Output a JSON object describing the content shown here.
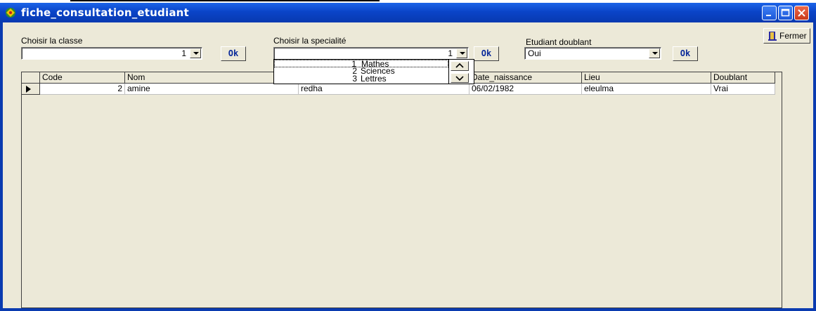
{
  "window": {
    "title": "fiche_consultation_etudiant"
  },
  "classe": {
    "label": "Choisir la classe",
    "value": "1",
    "ok": "Ok"
  },
  "specialite": {
    "label": "Choisir la specialité",
    "value": "1",
    "ok": "Ok",
    "options": [
      {
        "num": "1",
        "label": "Mathes"
      },
      {
        "num": "2",
        "label": "Sciences"
      },
      {
        "num": "3",
        "label": "Lettres"
      }
    ]
  },
  "doublant": {
    "label": "Etudiant doublant",
    "value": "Oui",
    "ok": "Ok"
  },
  "fermer": {
    "label": "Fermer"
  },
  "grid": {
    "columns": [
      "Code",
      "Nom",
      "",
      "Date_naissance",
      "Lieu",
      "Doublant"
    ],
    "rows": [
      [
        "2",
        "amine",
        "redha",
        "06/02/1982",
        "eleulma",
        "Vrai"
      ]
    ]
  }
}
